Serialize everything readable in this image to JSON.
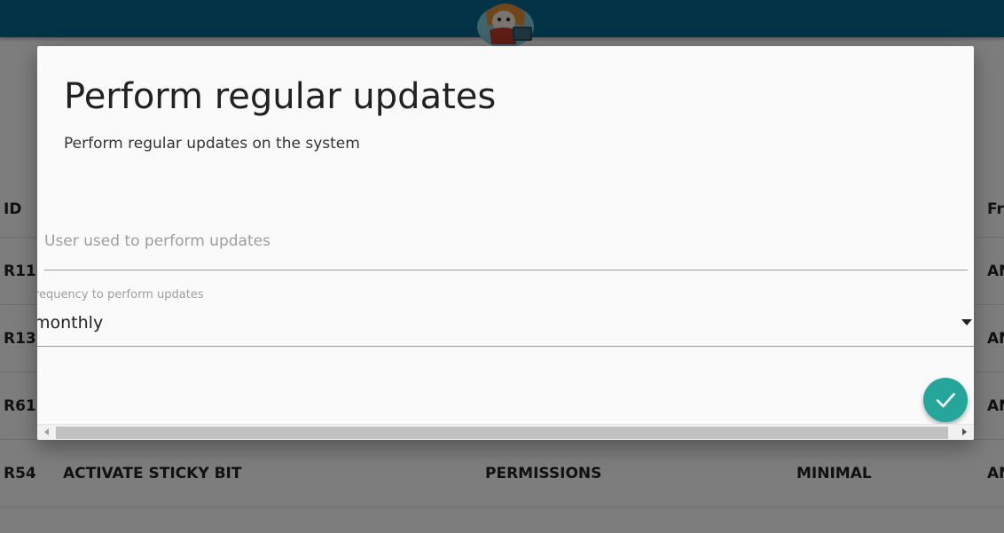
{
  "table": {
    "headers": {
      "id": "ID",
      "freq": "Fr"
    },
    "rows": [
      {
        "id": "R11",
        "name": "",
        "category": "",
        "level": "",
        "freq": "AN"
      },
      {
        "id": "R13",
        "name": "",
        "category": "",
        "level": "",
        "freq": "AN"
      },
      {
        "id": "R61",
        "name": "",
        "category": "",
        "level": "",
        "freq": "AN"
      },
      {
        "id": "R54",
        "name": "ACTIVATE STICKY BIT",
        "category": "PERMISSIONS",
        "level": "MINIMAL",
        "freq": "AN"
      }
    ]
  },
  "dialog": {
    "title": "Perform regular updates",
    "subtitle": "Perform regular updates on the system",
    "user_field": {
      "placeholder": "User used to perform updates",
      "value": ""
    },
    "frequency_field": {
      "label": "requency to perform updates",
      "value": "monthly"
    },
    "confirm_icon": "check-icon"
  },
  "colors": {
    "topbar": "#05668d",
    "fab": "#26a69a",
    "scrim": "rgba(0,0,0,0.5)"
  }
}
